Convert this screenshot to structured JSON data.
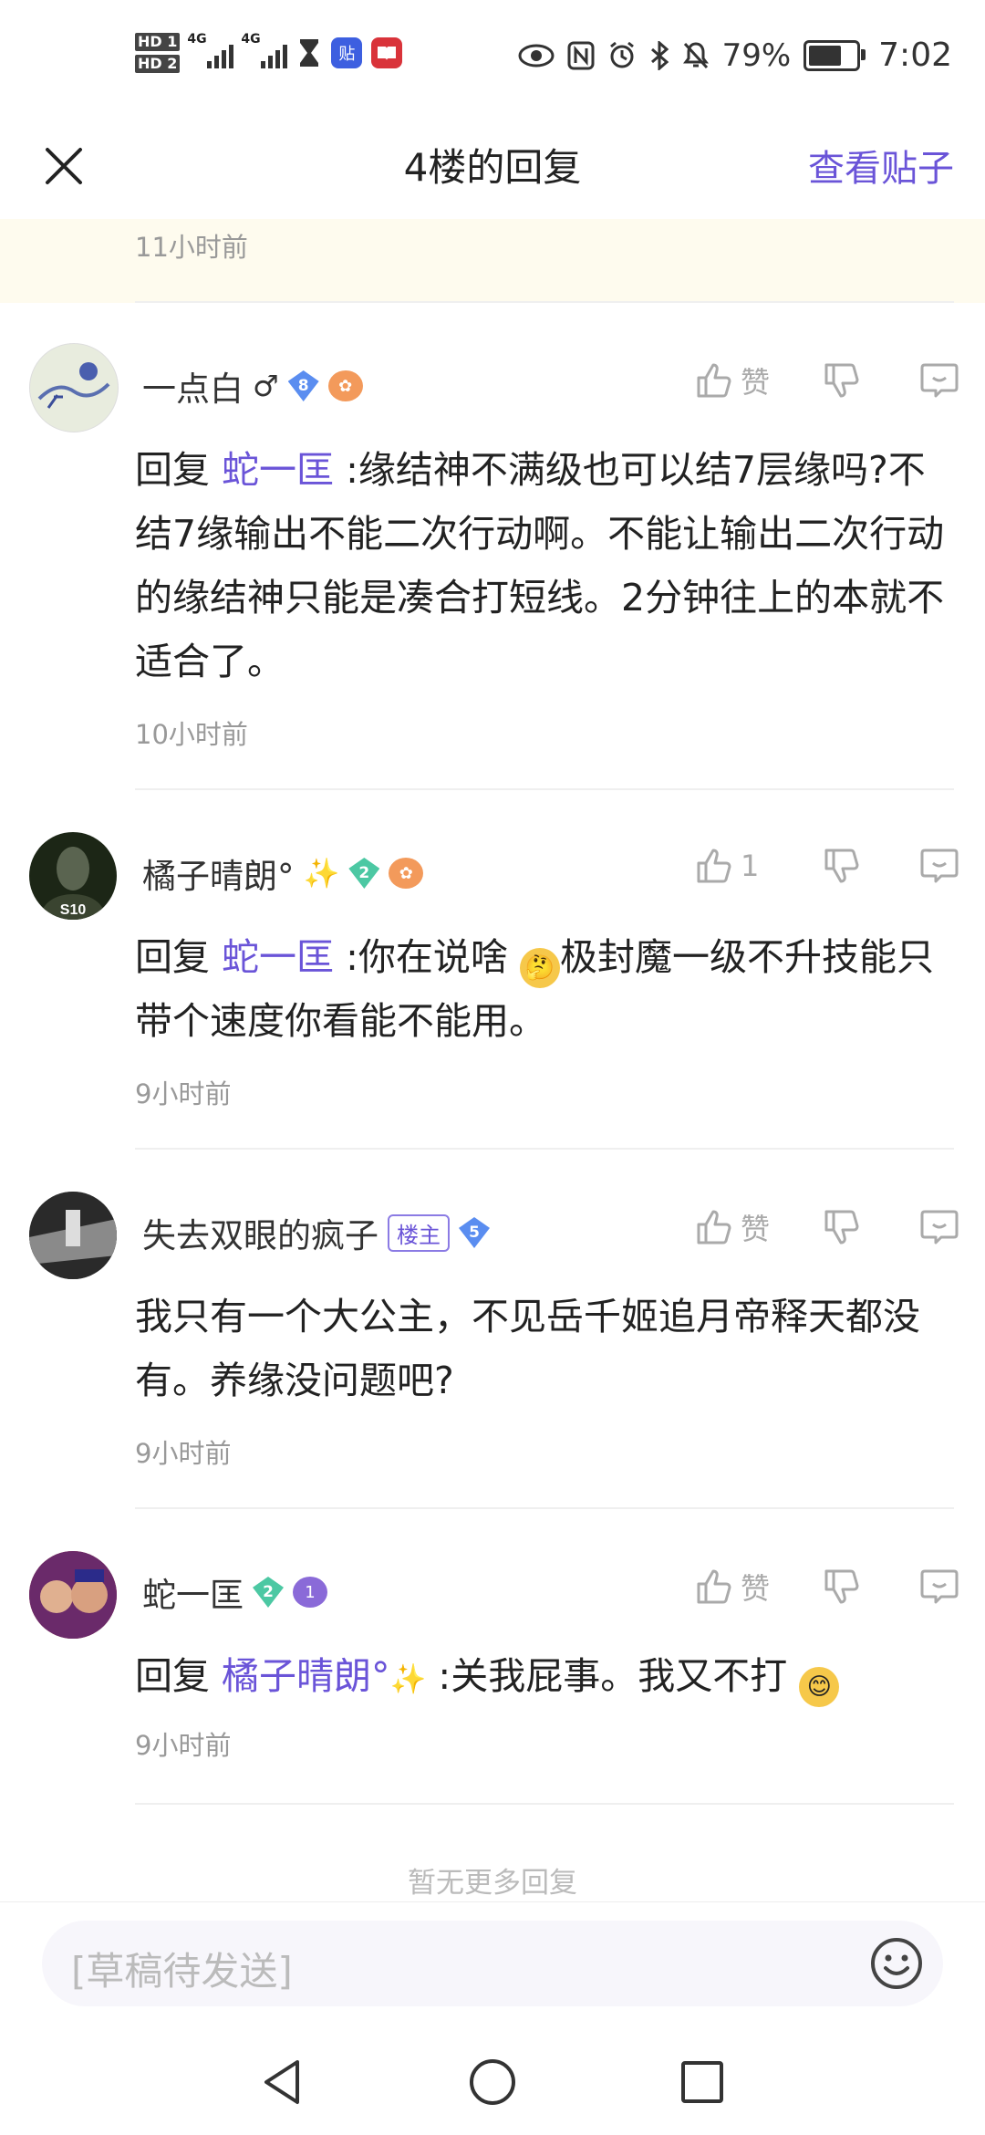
{
  "status_bar": {
    "hd1": "HD 1",
    "hd2": "HD 2",
    "net1": "4G",
    "net2": "4G",
    "battery_pct": "79%",
    "battery_level": 0.79,
    "time": "7:02",
    "tieba_icon_glyph": "贴"
  },
  "header": {
    "title": "4楼的回复",
    "view_post": "查看贴子"
  },
  "top_time": "11小时前",
  "comments": [
    {
      "username": "一点白",
      "gender": "♂",
      "level": "8",
      "reply_prefix": "回复",
      "mention": "蛇一匡",
      "text": " :缘结神不满级也可以结7层缘吗?不结7缘输出不能二次行动啊。不能让输出二次行动的缘结神只能是凑合打短线。2分钟往上的本就不适合了。",
      "like": "赞",
      "time": "10小时前"
    },
    {
      "username": "橘子晴朗°",
      "level": "2",
      "avatar_label": "S10",
      "reply_prefix": "回复",
      "mention": "蛇一匡",
      "text_a": " :你在说啥",
      "text_b": "极封魔一级不升技能只带个速度你看能不能用。",
      "like": "1",
      "time": "9小时前"
    },
    {
      "username": "失去双眼的疯子",
      "host_tag": "楼主",
      "level": "5",
      "text": "我只有一个大公主，不见岳千姬追月帝释天都没有。养缘没问题吧?",
      "like": "赞",
      "time": "9小时前"
    },
    {
      "username": "蛇一匡",
      "level": "2",
      "badge": "1",
      "reply_prefix": "回复",
      "mention": "橘子晴朗°",
      "text": " :关我屁事。我又不打",
      "like": "赞",
      "time": "9小时前"
    }
  ],
  "no_more": "暂无更多回复",
  "input": {
    "placeholder": "[草稿待发送]"
  },
  "icons": {
    "close": "close-icon",
    "like": "thumbs-up-icon",
    "dislike": "thumbs-down-icon",
    "reply": "comment-icon",
    "emoji": "smiley-icon",
    "back": "back-triangle-icon",
    "home": "home-circle-icon",
    "recent": "recent-square-icon"
  },
  "colors": {
    "accent": "#6a54d8",
    "highlight_bg": "#fefbee",
    "meta_text": "#999999"
  }
}
